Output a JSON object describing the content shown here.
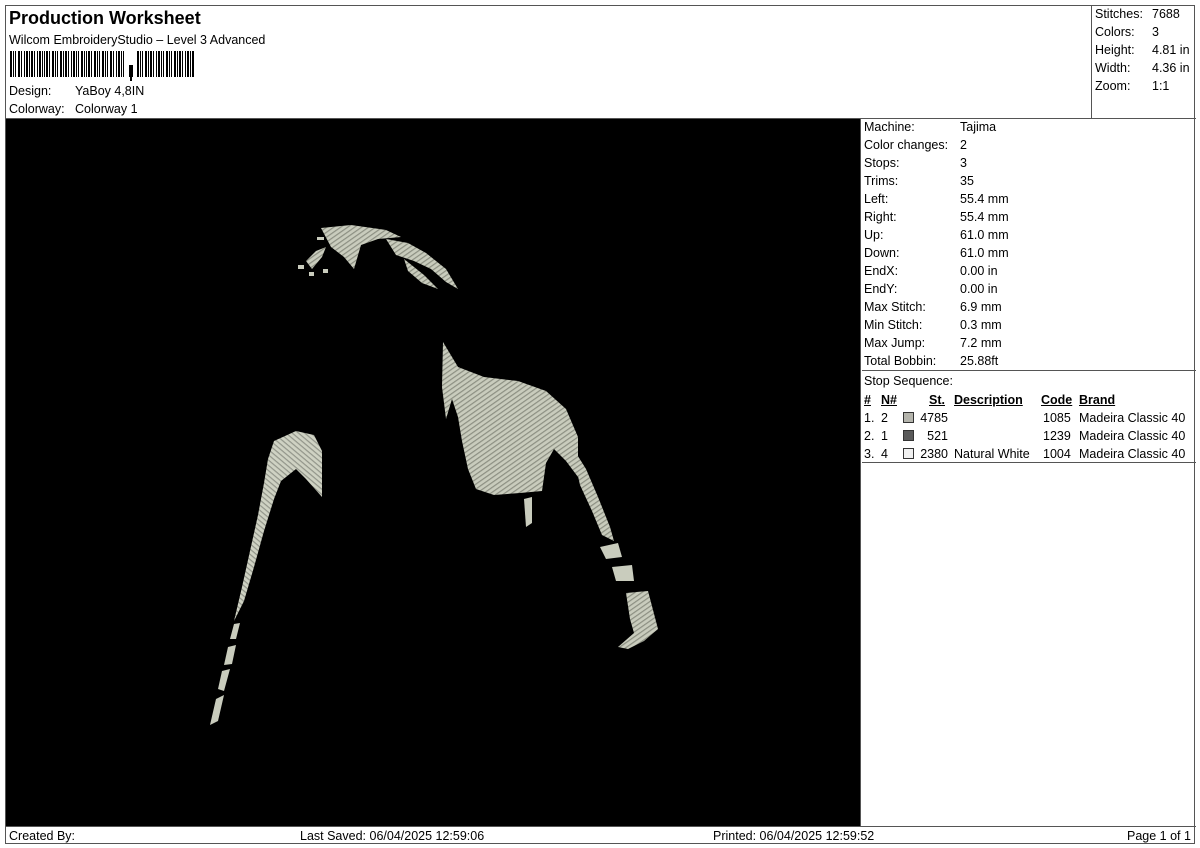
{
  "header": {
    "title": "Production Worksheet",
    "subtitle": "Wilcom EmbroideryStudio – Level 3 Advanced",
    "design_label": "Design:",
    "design_value": "YaBoy 4,8IN",
    "colorway_label": "Colorway:",
    "colorway_value": "Colorway 1"
  },
  "summary": {
    "stitches_label": "Stitches:",
    "stitches_value": "7688",
    "colors_label": "Colors:",
    "colors_value": "3",
    "height_label": "Height:",
    "height_value": "4.81 in",
    "width_label": "Width:",
    "width_value": "4.36 in",
    "zoom_label": "Zoom:",
    "zoom_value": "1:1"
  },
  "params": [
    {
      "label": "Machine:",
      "value": "Tajima"
    },
    {
      "label": "Color changes:",
      "value": "2"
    },
    {
      "label": "Stops:",
      "value": "3"
    },
    {
      "label": "Trims:",
      "value": "35"
    },
    {
      "label": "Left:",
      "value": "55.4 mm"
    },
    {
      "label": "Right:",
      "value": "55.4 mm"
    },
    {
      "label": "Up:",
      "value": "61.0 mm"
    },
    {
      "label": "Down:",
      "value": "61.0 mm"
    },
    {
      "label": "EndX:",
      "value": "0.00 in"
    },
    {
      "label": "EndY:",
      "value": "0.00 in"
    },
    {
      "label": "Max Stitch:",
      "value": "6.9 mm"
    },
    {
      "label": "Min Stitch:",
      "value": "0.3 mm"
    },
    {
      "label": "Max Jump:",
      "value": "7.2 mm"
    },
    {
      "label": "Total Bobbin:",
      "value": "25.88ft"
    }
  ],
  "stops": {
    "title": "Stop Sequence:",
    "headers": {
      "num": "#",
      "needle": "N#",
      "stitches": "St.",
      "description": "Description",
      "code": "Code",
      "brand": "Brand"
    },
    "rows": [
      {
        "num": "1.",
        "needle": "2",
        "color": "#b4b4ac",
        "stitches": "4785",
        "description": "",
        "code": "1085",
        "brand": "Madeira Classic 40"
      },
      {
        "num": "2.",
        "needle": "1",
        "color": "#5a5a5a",
        "stitches": "521",
        "description": "",
        "code": "1239",
        "brand": "Madeira Classic 40"
      },
      {
        "num": "3.",
        "needle": "4",
        "color": "#f0f0f0",
        "stitches": "2380",
        "description": "Natural White",
        "code": "1004",
        "brand": "Madeira Classic 40"
      }
    ]
  },
  "footer": {
    "created": "Created By:",
    "saved": "Last Saved: 06/04/2025 12:59:06",
    "printed": "Printed: 06/04/2025 12:59:52",
    "page": "Page 1 of 1"
  },
  "colors": {
    "preview_bg": "#000000",
    "thread_main": "#c9ccbd",
    "thread_dark": "#8c8f82"
  }
}
